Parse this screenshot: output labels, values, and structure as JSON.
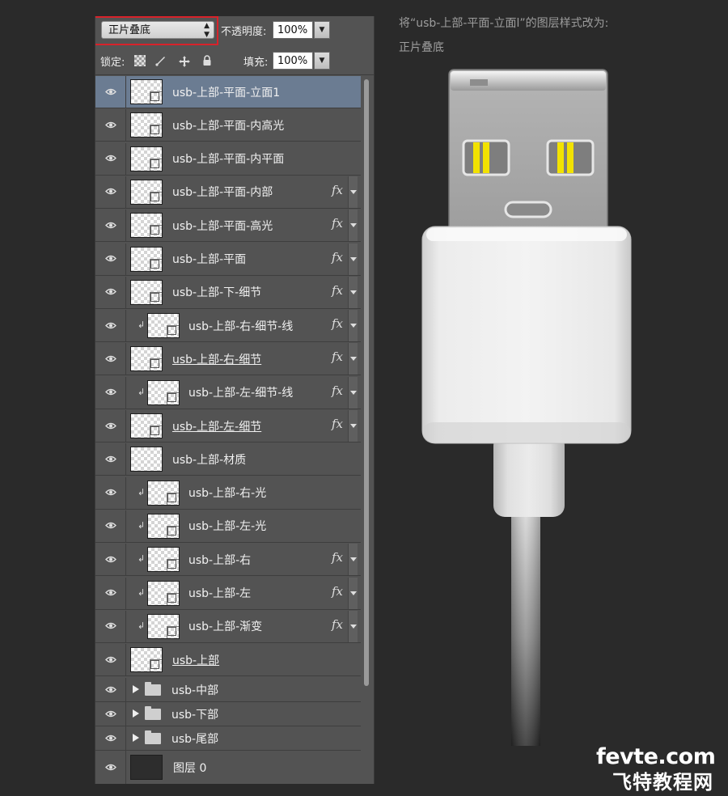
{
  "panel": {
    "blend_mode": "正片叠底",
    "opacity_label": "不透明度:",
    "opacity_value": "100%",
    "lock_label": "锁定:",
    "fill_label": "填充:",
    "fill_value": "100%",
    "lock_icons": [
      "lock-transparent-pixels-icon",
      "lock-image-pixels-icon",
      "lock-position-icon",
      "lock-all-icon"
    ]
  },
  "layers": [
    {
      "name": "usb-上部-平面-立面1",
      "selected": true,
      "fx": false,
      "clipped": false,
      "underline": false
    },
    {
      "name": "usb-上部-平面-内高光",
      "fx": false,
      "clipped": false,
      "underline": false
    },
    {
      "name": "usb-上部-平面-内平面",
      "fx": false,
      "clipped": false,
      "underline": false
    },
    {
      "name": "usb-上部-平面-内部",
      "fx": true,
      "clipped": false,
      "underline": false
    },
    {
      "name": "usb-上部-平面-高光",
      "fx": true,
      "clipped": false,
      "underline": false
    },
    {
      "name": "usb-上部-平面",
      "fx": true,
      "clipped": false,
      "underline": false
    },
    {
      "name": "usb-上部-下-细节",
      "fx": true,
      "clipped": false,
      "underline": false
    },
    {
      "name": "usb-上部-右-细节-线",
      "fx": true,
      "clipped": true,
      "underline": false
    },
    {
      "name": "usb-上部-右-细节",
      "fx": true,
      "clipped": false,
      "underline": true
    },
    {
      "name": "usb-上部-左-细节-线",
      "fx": true,
      "clipped": true,
      "underline": false
    },
    {
      "name": "usb-上部-左-细节",
      "fx": true,
      "clipped": false,
      "underline": true
    },
    {
      "name": "usb-上部-材质",
      "fx": false,
      "clipped": false,
      "underline": false,
      "plain_thumb": true
    },
    {
      "name": "usb-上部-右-光",
      "fx": false,
      "clipped": true,
      "underline": false
    },
    {
      "name": "usb-上部-左-光",
      "fx": false,
      "clipped": true,
      "underline": false
    },
    {
      "name": "usb-上部-右",
      "fx": true,
      "clipped": true,
      "underline": false
    },
    {
      "name": "usb-上部-左",
      "fx": true,
      "clipped": true,
      "underline": false
    },
    {
      "name": "usb-上部-渐变",
      "fx": true,
      "clipped": true,
      "underline": false
    },
    {
      "name": "usb-上部",
      "fx": false,
      "clipped": false,
      "underline": true
    }
  ],
  "groups": [
    {
      "name": "usb-中部"
    },
    {
      "name": "usb-下部"
    },
    {
      "name": "usb-尾部"
    }
  ],
  "bottom_layer": {
    "name": "图层 0"
  },
  "instruction": {
    "line1": "将“usb-上部-平面-立面l”的图层样式改为:",
    "line2": "正片叠底"
  },
  "watermark": {
    "line1": "fevte.com",
    "line2": "飞特教程网"
  },
  "colors": {
    "panel_bg": "#535353",
    "selected_row": "#6b7c92",
    "highlight_border": "#d8222a",
    "background": "#2a2a2a"
  }
}
